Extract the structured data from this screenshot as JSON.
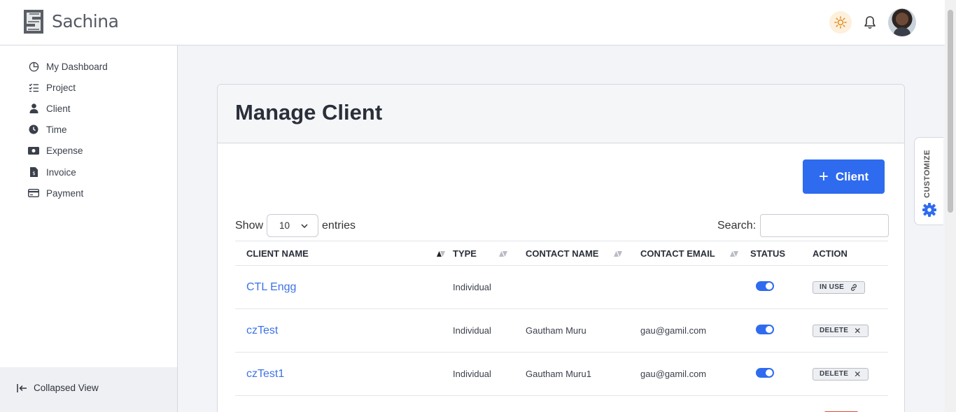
{
  "header": {
    "brand": "Sachina",
    "icons": [
      "logo-icon",
      "sun-icon",
      "bell-icon",
      "avatar"
    ]
  },
  "sidebar": {
    "items": [
      {
        "label": "My Dashboard",
        "icon": "pie-chart-icon"
      },
      {
        "label": "Project",
        "icon": "checklist-icon"
      },
      {
        "label": "Client",
        "icon": "user-icon"
      },
      {
        "label": "Time",
        "icon": "clock-icon"
      },
      {
        "label": "Expense",
        "icon": "cash-icon"
      },
      {
        "label": "Invoice",
        "icon": "invoice-icon"
      },
      {
        "label": "Payment",
        "icon": "credit-card-icon"
      }
    ],
    "collapse_label": "Collapsed View"
  },
  "page": {
    "title": "Manage Client",
    "add_button": "Client",
    "show_label": "Show",
    "entries_value": "10",
    "entries_label": "entries",
    "search_label": "Search:",
    "search_value": ""
  },
  "table": {
    "columns": [
      "CLIENT NAME",
      "TYPE",
      "CONTACT NAME",
      "CONTACT EMAIL",
      "STATUS",
      "ACTION"
    ],
    "rows": [
      {
        "client_name": "CTL Engg",
        "type": "Individual",
        "contact_name": "",
        "contact_email": "",
        "status": "on",
        "action": "IN USE"
      },
      {
        "client_name": "czTest",
        "type": "Individual",
        "contact_name": "Gautham Muru",
        "contact_email": "gau@gamil.com",
        "status": "on",
        "action": "DELETE"
      },
      {
        "client_name": "czTest1",
        "type": "Individual",
        "contact_name": "Gautham Muru1",
        "contact_email": "gau@gamil.com",
        "status": "on",
        "action": "DELETE"
      }
    ]
  },
  "customize_label": "CUSTOMIZE",
  "colors": {
    "accent": "#2f6bef",
    "link": "#3d72e6",
    "danger": "#e04a3b"
  }
}
